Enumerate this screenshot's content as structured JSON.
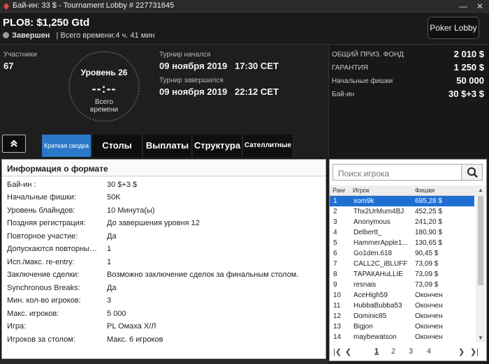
{
  "window": {
    "title": "Бай-ин: 33 $ - Tournament Lobby # 227731645"
  },
  "header": {
    "tournament_name": "PLO8: $1,250 Gtd",
    "status": "Завершен",
    "total_time": "| Всего времени:4 ч. 41 мин",
    "lobby_button": "Poker Lobby"
  },
  "info": {
    "participants_label": "Участники",
    "participants_value": "67",
    "level": "Уровень 26",
    "timer": "--:--",
    "total_time_label": "Всего\nвремени",
    "started_label": "Турнир начался",
    "started_value": "09 ноября 2019   17:30 CET",
    "finished_label": "Турнир завершился",
    "finished_value": "09 ноября 2019   22:12 CET"
  },
  "prize": [
    {
      "label": "ОБЩИЙ ПРИЗ. ФОНД",
      "value": "2 010 $"
    },
    {
      "label": "ГАРАНТИЯ",
      "value": "1 250 $"
    },
    {
      "label": "Начальные фишки",
      "value": "50 000"
    },
    {
      "label": "Бай-ин",
      "value": "30 $+3 $"
    }
  ],
  "tabs": [
    "Краткая сводка",
    "Столы",
    "Выплаты",
    "Структура",
    "Сателлитные"
  ],
  "format": {
    "title": "Информация о формате",
    "rows": [
      {
        "label": "Бай-ин :",
        "value": "30 $+3 $"
      },
      {
        "label": "Начальные фишки:",
        "value": "50K"
      },
      {
        "label": "Уровень блайндов:",
        "value": "10 Минута(ы)"
      },
      {
        "label": "Поздняя регистрация:",
        "value": "До завершения уровня 12"
      },
      {
        "label": "Повторное участие:",
        "value": "Да"
      },
      {
        "label": "Допускаются повторные ...",
        "value": "1"
      },
      {
        "label": "Исп./макс. re-entry:",
        "value": "1"
      },
      {
        "label": "Заключение сделки:",
        "value": "Возможно заключение сделок за финальным столом."
      },
      {
        "label": "Synchronous Breaks:",
        "value": "Да"
      },
      {
        "label": "Мин. кол-во игроков:",
        "value": "3"
      },
      {
        "label": "Макс. игроков:",
        "value": "5 000"
      },
      {
        "label": "Игра:",
        "value": "PL Омаха Х/Л"
      },
      {
        "label": "Игроков за столом:",
        "value": "Макс. 6 игроков"
      }
    ]
  },
  "players": {
    "search_placeholder": "Поиск игрока",
    "columns": [
      "Ранг",
      "Игрок",
      "Фишки"
    ],
    "rows": [
      {
        "rank": "1",
        "name": "xom9k",
        "chips": "695,28 $"
      },
      {
        "rank": "2",
        "name": "Thx2UrMum4BJ",
        "chips": "452,25 $"
      },
      {
        "rank": "3",
        "name": "Anonymous",
        "chips": "241,20 $"
      },
      {
        "rank": "4",
        "name": "Delbertt_",
        "chips": "180,90 $"
      },
      {
        "rank": "5",
        "name": "HammerApple1...",
        "chips": "130,65 $"
      },
      {
        "rank": "6",
        "name": "Go1den.618",
        "chips": "90,45 $"
      },
      {
        "rank": "7",
        "name": "CALL2C_iBLUFF",
        "chips": "73,09 $"
      },
      {
        "rank": "8",
        "name": "ТАРАКАНuLLIE",
        "chips": "73,09 $"
      },
      {
        "rank": "9",
        "name": "resnais",
        "chips": "73,09 $"
      },
      {
        "rank": "10",
        "name": "AceHigh59",
        "chips": "Окончен"
      },
      {
        "rank": "11",
        "name": "HubbaBubba53",
        "chips": "Окончен"
      },
      {
        "rank": "12",
        "name": "Dominic85",
        "chips": "Окончен"
      },
      {
        "rank": "13",
        "name": "Bigjon",
        "chips": "Окончен"
      },
      {
        "rank": "14",
        "name": "maybewatson",
        "chips": "Окончен"
      }
    ],
    "pages": [
      "1",
      "2",
      "3",
      "4"
    ]
  },
  "colors": {
    "accent_tab": "#2b78c8",
    "selected_row": "#1f6fd2"
  }
}
